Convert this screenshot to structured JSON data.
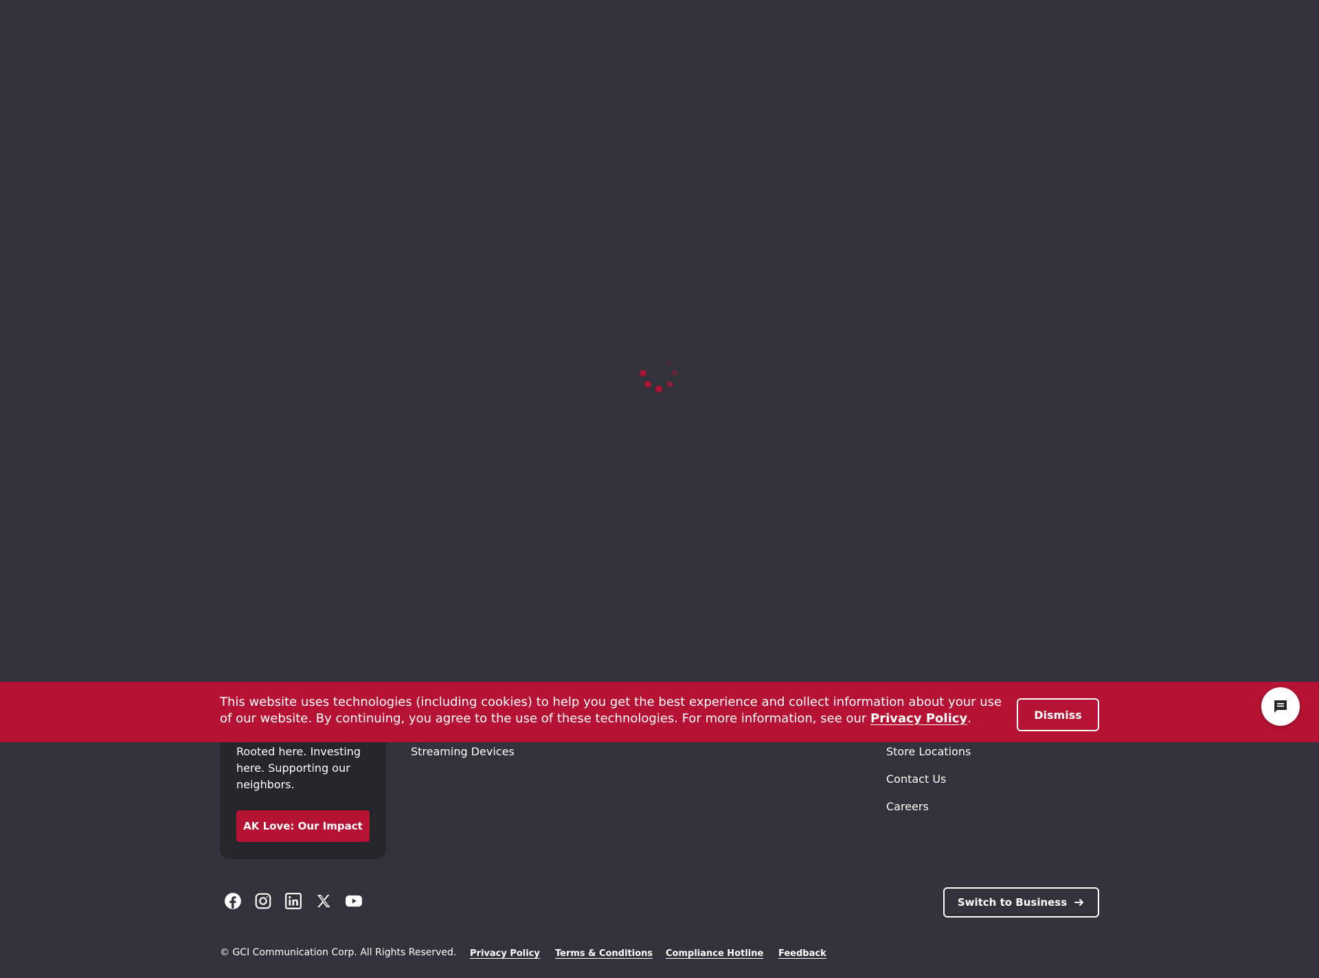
{
  "colors": {
    "background": "#31323a",
    "accent": "#b51234",
    "card": "#25262c",
    "text": "#ffffff"
  },
  "loading": {
    "icon": "loading-spinner-icon"
  },
  "cookie_banner": {
    "text_before_link": "This website uses technologies (including cookies) to help you get the best experience and collect information about your use of our website. By continuing, you agree to the use of these technologies. For more information, see our ",
    "link_label": "Privacy Policy",
    "text_after_link": ".",
    "dismiss_label": "Dismiss"
  },
  "chat": {
    "icon": "chat-bubble-icon"
  },
  "footer": {
    "impact_card": {
      "text": "Rooted here. Investing here. Supporting our neighbors.",
      "button_label": "AK Love: Our Impact"
    },
    "column_links": {
      "streaming_devices": "Streaming Devices",
      "store_locations": "Store Locations",
      "contact_us": "Contact Us",
      "careers": "Careers"
    },
    "social": [
      "facebook-icon",
      "instagram-icon",
      "linkedin-icon",
      "x-icon",
      "youtube-icon"
    ],
    "switch_label": "Switch to Business",
    "copyright": "© GCI Communication Corp. All Rights Reserved.",
    "legal": {
      "privacy": "Privacy Policy",
      "terms": "Terms & Conditions",
      "compliance": "Compliance Hotline",
      "feedback": "Feedback"
    }
  }
}
